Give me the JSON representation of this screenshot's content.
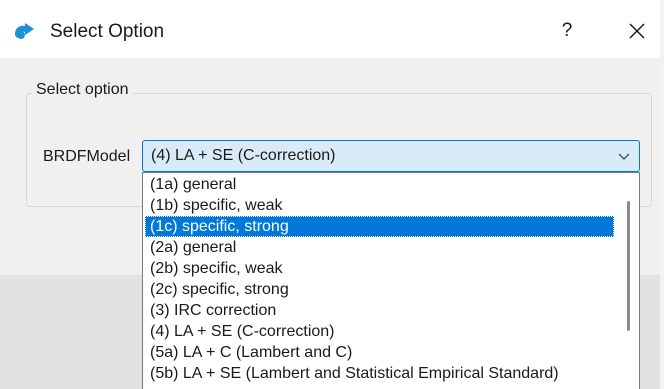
{
  "window": {
    "title": "Select Option",
    "help_label": "?",
    "icon": "app-arrow-icon",
    "close_icon": "close-icon"
  },
  "group": {
    "title": "Select option"
  },
  "field": {
    "label": "BRDFModel",
    "selected_value": "(4) LA + SE (C-correction)"
  },
  "dropdown": {
    "options": [
      "(1a) general",
      "(1b) specific, weak",
      "(1c) specific, strong",
      "(2a) general",
      "(2b) specific, weak",
      "(2c) specific, strong",
      "(3) IRC correction",
      "(4) LA + SE (C-correction)",
      "(5a) LA + C (Lambert and C)",
      "(5b) LA + SE (Lambert and Statistical Empirical Standard)"
    ],
    "highlighted": "(1c) specific, strong"
  },
  "colors": {
    "accent": "#0078d7",
    "combo_bg": "#d9ebf9",
    "client_bg": "#f0f0f0"
  }
}
